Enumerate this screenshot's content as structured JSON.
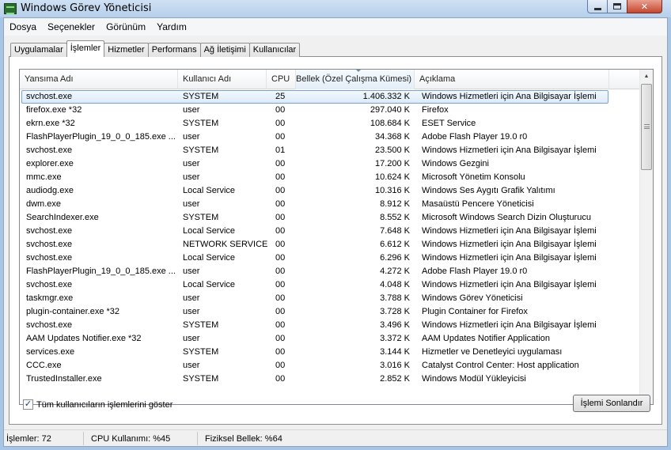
{
  "window": {
    "title": "Windows Görev Yöneticisi"
  },
  "menu": [
    "Dosya",
    "Seçenekler",
    "Görünüm",
    "Yardım"
  ],
  "tabs": [
    "Uygulamalar",
    "İşlemler",
    "Hizmetler",
    "Performans",
    "Ağ İletişimi",
    "Kullanıcılar"
  ],
  "active_tab": "İşlemler",
  "columns": {
    "name": "Yansıma Adı",
    "user": "Kullanıcı Adı",
    "cpu": "CPU",
    "memory": "Bellek (Özel Çalışma Kümesi)",
    "description": "Açıklama"
  },
  "processes": [
    {
      "name": "svchost.exe",
      "user": "SYSTEM",
      "cpu": "25",
      "memory": "1.406.332 K",
      "description": "Windows Hizmetleri için Ana Bilgisayar İşlemi"
    },
    {
      "name": "firefox.exe *32",
      "user": "user",
      "cpu": "00",
      "memory": "297.040 K",
      "description": "Firefox"
    },
    {
      "name": "ekrn.exe *32",
      "user": "SYSTEM",
      "cpu": "00",
      "memory": "108.684 K",
      "description": "ESET Service"
    },
    {
      "name": "FlashPlayerPlugin_19_0_0_185.exe ...",
      "user": "user",
      "cpu": "00",
      "memory": "34.368 K",
      "description": "Adobe Flash Player 19.0 r0"
    },
    {
      "name": "svchost.exe",
      "user": "SYSTEM",
      "cpu": "01",
      "memory": "23.500 K",
      "description": "Windows Hizmetleri için Ana Bilgisayar İşlemi"
    },
    {
      "name": "explorer.exe",
      "user": "user",
      "cpu": "00",
      "memory": "17.200 K",
      "description": "Windows Gezgini"
    },
    {
      "name": "mmc.exe",
      "user": "user",
      "cpu": "00",
      "memory": "10.624 K",
      "description": "Microsoft Yönetim Konsolu"
    },
    {
      "name": "audiodg.exe",
      "user": "Local Service",
      "cpu": "00",
      "memory": "10.316 K",
      "description": "Windows Ses Aygıtı Grafik Yalıtımı"
    },
    {
      "name": "dwm.exe",
      "user": "user",
      "cpu": "00",
      "memory": "8.912 K",
      "description": "Masaüstü Pencere Yöneticisi"
    },
    {
      "name": "SearchIndexer.exe",
      "user": "SYSTEM",
      "cpu": "00",
      "memory": "8.552 K",
      "description": "Microsoft Windows Search Dizin Oluşturucu"
    },
    {
      "name": "svchost.exe",
      "user": "Local Service",
      "cpu": "00",
      "memory": "7.648 K",
      "description": "Windows Hizmetleri için Ana Bilgisayar İşlemi"
    },
    {
      "name": "svchost.exe",
      "user": "NETWORK SERVICE",
      "cpu": "00",
      "memory": "6.612 K",
      "description": "Windows Hizmetleri için Ana Bilgisayar İşlemi"
    },
    {
      "name": "svchost.exe",
      "user": "Local Service",
      "cpu": "00",
      "memory": "6.296 K",
      "description": "Windows Hizmetleri için Ana Bilgisayar İşlemi"
    },
    {
      "name": "FlashPlayerPlugin_19_0_0_185.exe ...",
      "user": "user",
      "cpu": "00",
      "memory": "4.272 K",
      "description": "Adobe Flash Player 19.0 r0"
    },
    {
      "name": "svchost.exe",
      "user": "Local Service",
      "cpu": "00",
      "memory": "4.048 K",
      "description": "Windows Hizmetleri için Ana Bilgisayar İşlemi"
    },
    {
      "name": "taskmgr.exe",
      "user": "user",
      "cpu": "00",
      "memory": "3.788 K",
      "description": "Windows Görev Yöneticisi"
    },
    {
      "name": "plugin-container.exe *32",
      "user": "user",
      "cpu": "00",
      "memory": "3.728 K",
      "description": "Plugin Container for Firefox"
    },
    {
      "name": "svchost.exe",
      "user": "SYSTEM",
      "cpu": "00",
      "memory": "3.496 K",
      "description": "Windows Hizmetleri için Ana Bilgisayar İşlemi"
    },
    {
      "name": "AAM Updates Notifier.exe *32",
      "user": "user",
      "cpu": "00",
      "memory": "3.372 K",
      "description": "AAM Updates Notifier Application"
    },
    {
      "name": "services.exe",
      "user": "SYSTEM",
      "cpu": "00",
      "memory": "3.144 K",
      "description": "Hizmetler ve Denetleyici uygulaması"
    },
    {
      "name": "CCC.exe",
      "user": "user",
      "cpu": "00",
      "memory": "3.016 K",
      "description": "Catalyst Control Center: Host application"
    },
    {
      "name": "TrustedInstaller.exe",
      "user": "SYSTEM",
      "cpu": "00",
      "memory": "2.852 K",
      "description": "Windows Modül Yükleyicisi"
    }
  ],
  "selected_index": 0,
  "show_all_users": {
    "label": "Tüm kullanıcıların işlemlerini göster",
    "checked": true,
    "mark": "✓"
  },
  "end_process_label": "İşlemi Sonlandır",
  "status": {
    "processes": "İşlemler: 72",
    "cpu": "CPU Kullanımı: %45",
    "memory": "Fiziksel Bellek: %64"
  },
  "colors": {
    "selection_border": "#7da2ce",
    "title_bar": "#b6cfeb",
    "close_button": "#c5462f"
  },
  "icons": {
    "app": "task-manager-icon",
    "minimize": "minimize-icon",
    "maximize": "maximize-icon",
    "close": "close-icon",
    "scroll_up": "scroll-up-arrow-icon",
    "scroll_down": "scroll-down-arrow-icon"
  }
}
